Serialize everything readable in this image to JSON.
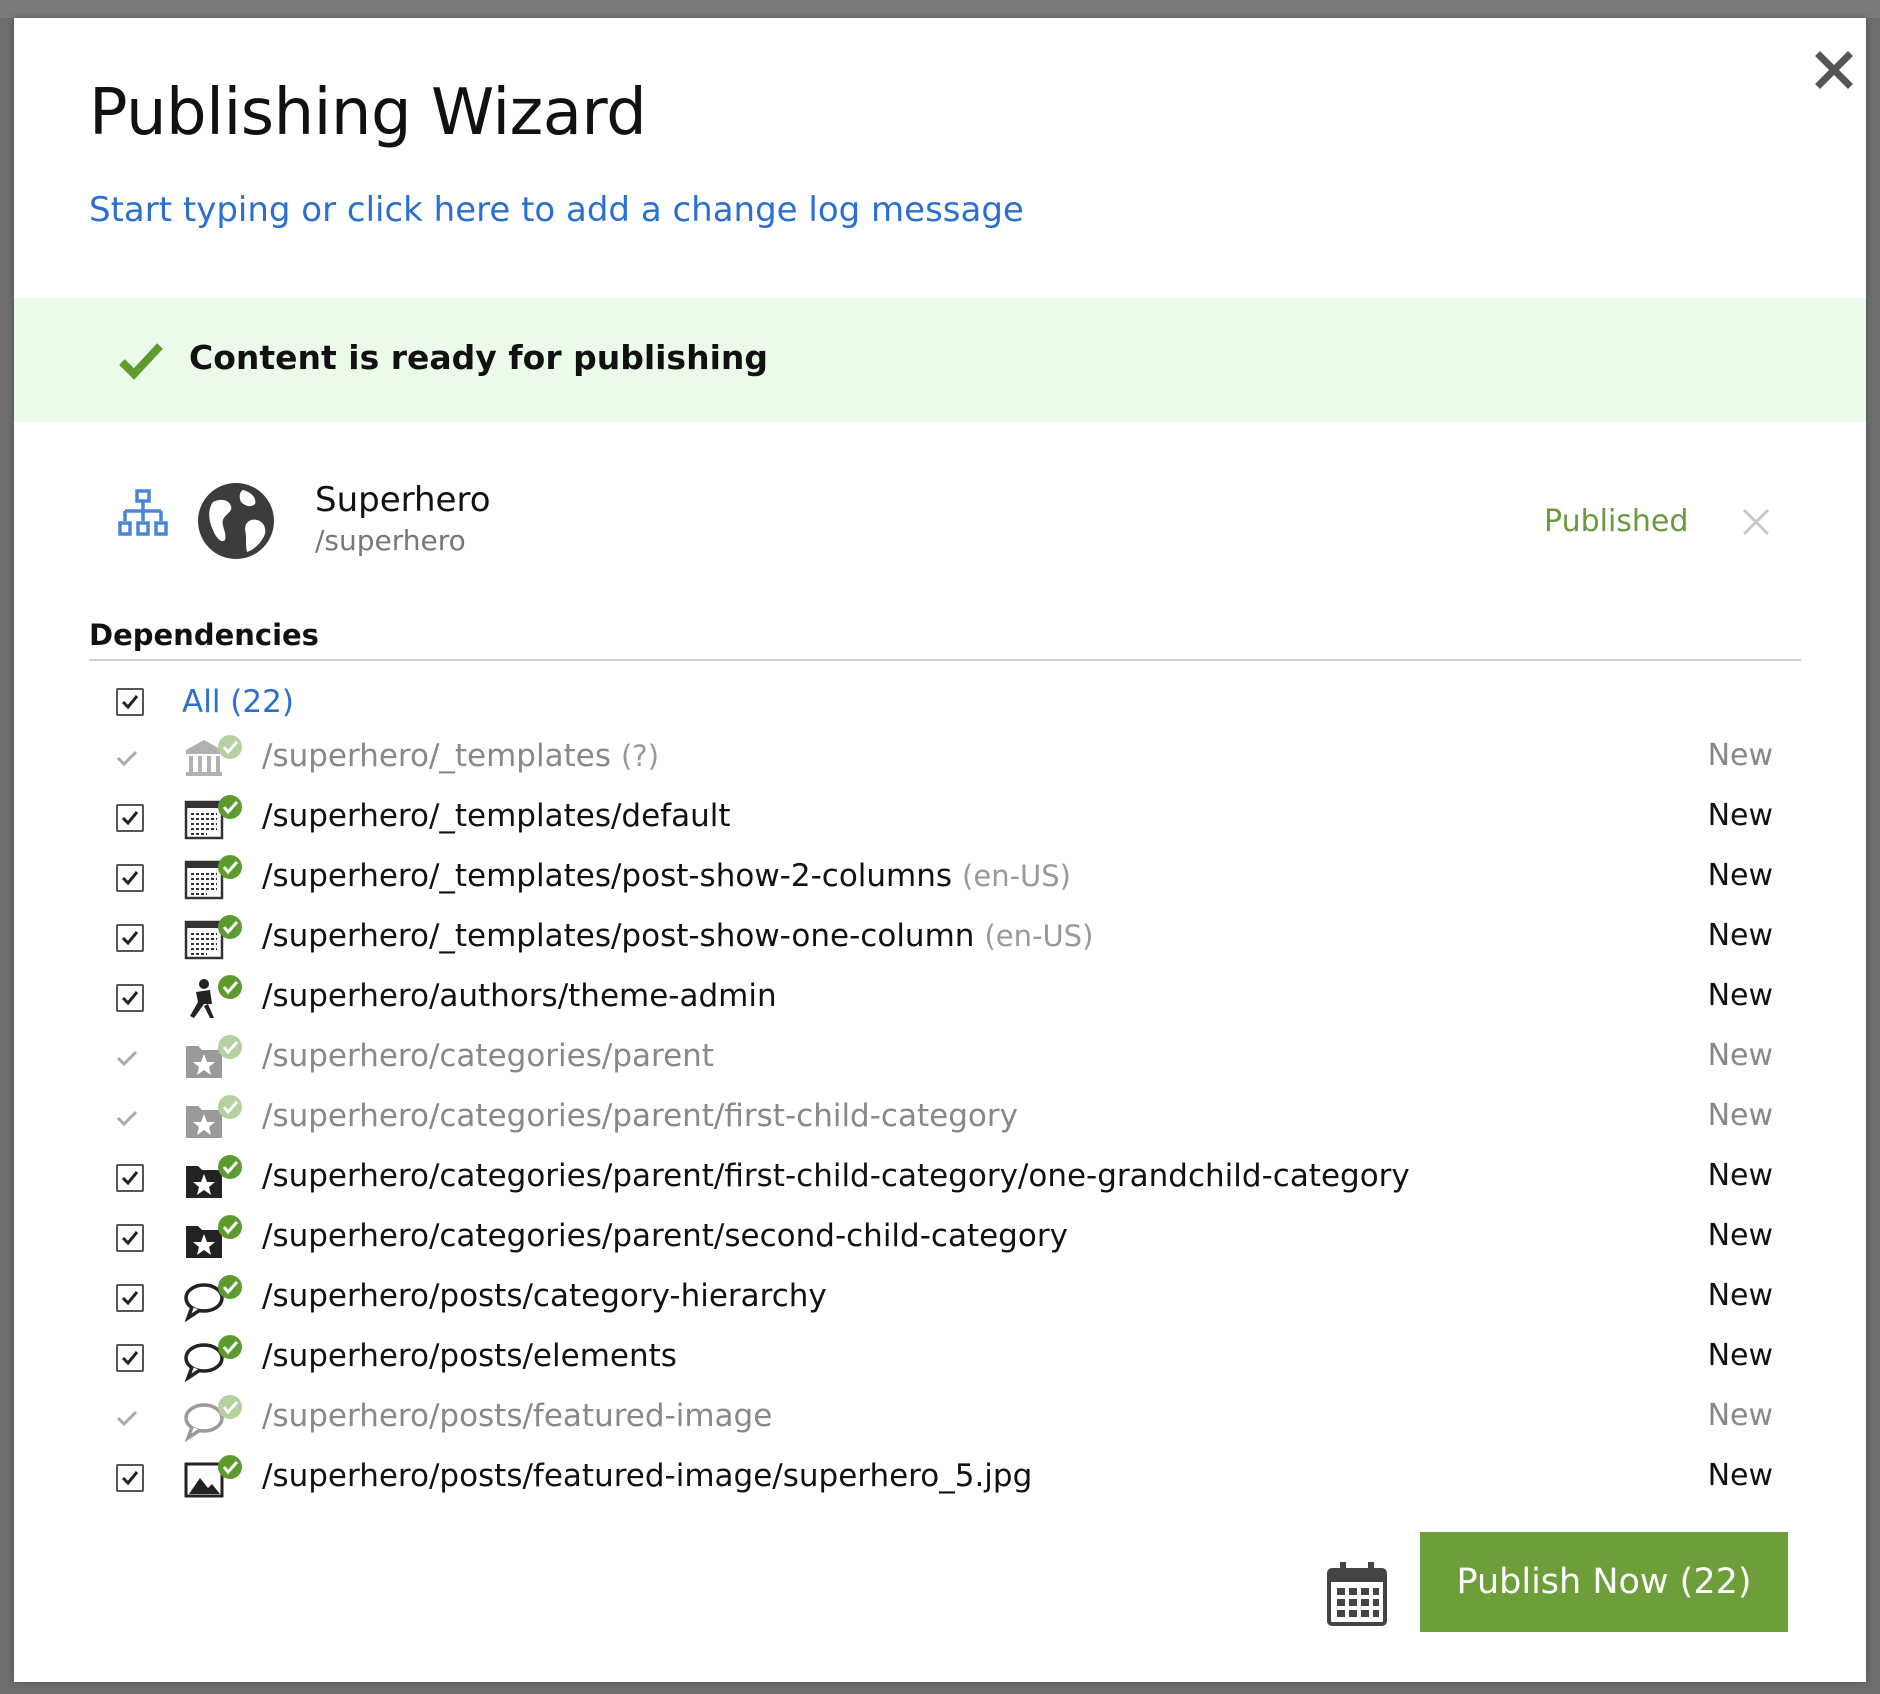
{
  "dialog": {
    "title": "Publishing Wizard",
    "changelog_link": "Start typing or click here to add a change log message",
    "banner_text": "Content is ready for publishing"
  },
  "root_item": {
    "name": "Superhero",
    "path": "/superhero",
    "status": "Published"
  },
  "dependencies": {
    "heading": "Dependencies",
    "all_label": "All (22)",
    "items": [
      {
        "path": "/superhero/_templates",
        "locale": "(?)",
        "status": "New",
        "checkbox": false,
        "muted": true,
        "icon": "template-folder-icon"
      },
      {
        "path": "/superhero/_templates/default",
        "locale": "",
        "status": "New",
        "checkbox": true,
        "muted": false,
        "icon": "template-icon"
      },
      {
        "path": "/superhero/_templates/post-show-2-columns",
        "locale": "(en-US)",
        "status": "New",
        "checkbox": true,
        "muted": false,
        "icon": "template-icon"
      },
      {
        "path": "/superhero/_templates/post-show-one-column",
        "locale": "(en-US)",
        "status": "New",
        "checkbox": true,
        "muted": false,
        "icon": "template-icon"
      },
      {
        "path": "/superhero/authors/theme-admin",
        "locale": "",
        "status": "New",
        "checkbox": true,
        "muted": false,
        "icon": "author-icon"
      },
      {
        "path": "/superhero/categories/parent",
        "locale": "",
        "status": "New",
        "checkbox": false,
        "muted": true,
        "icon": "category-icon"
      },
      {
        "path": "/superhero/categories/parent/first-child-category",
        "locale": "",
        "status": "New",
        "checkbox": false,
        "muted": true,
        "icon": "category-icon"
      },
      {
        "path": "/superhero/categories/parent/first-child-category/one-grandchild-category",
        "locale": "",
        "status": "New",
        "checkbox": true,
        "muted": false,
        "icon": "category-icon"
      },
      {
        "path": "/superhero/categories/parent/second-child-category",
        "locale": "",
        "status": "New",
        "checkbox": true,
        "muted": false,
        "icon": "category-icon"
      },
      {
        "path": "/superhero/posts/category-hierarchy",
        "locale": "",
        "status": "New",
        "checkbox": true,
        "muted": false,
        "icon": "post-icon"
      },
      {
        "path": "/superhero/posts/elements",
        "locale": "",
        "status": "New",
        "checkbox": true,
        "muted": false,
        "icon": "post-icon"
      },
      {
        "path": "/superhero/posts/featured-image",
        "locale": "",
        "status": "New",
        "checkbox": false,
        "muted": true,
        "icon": "post-icon"
      },
      {
        "path": "/superhero/posts/featured-image/superhero_5.jpg",
        "locale": "",
        "status": "New",
        "checkbox": true,
        "muted": false,
        "icon": "image-icon"
      }
    ]
  },
  "footer": {
    "publish_label": "Publish Now (22)"
  },
  "colors": {
    "accent_blue": "#2b6fd2",
    "publish_green": "#6d9e3a",
    "banner_bg": "#eafbe9",
    "status_published": "#6a9a3c",
    "badge_green": "#5d9b2f"
  }
}
